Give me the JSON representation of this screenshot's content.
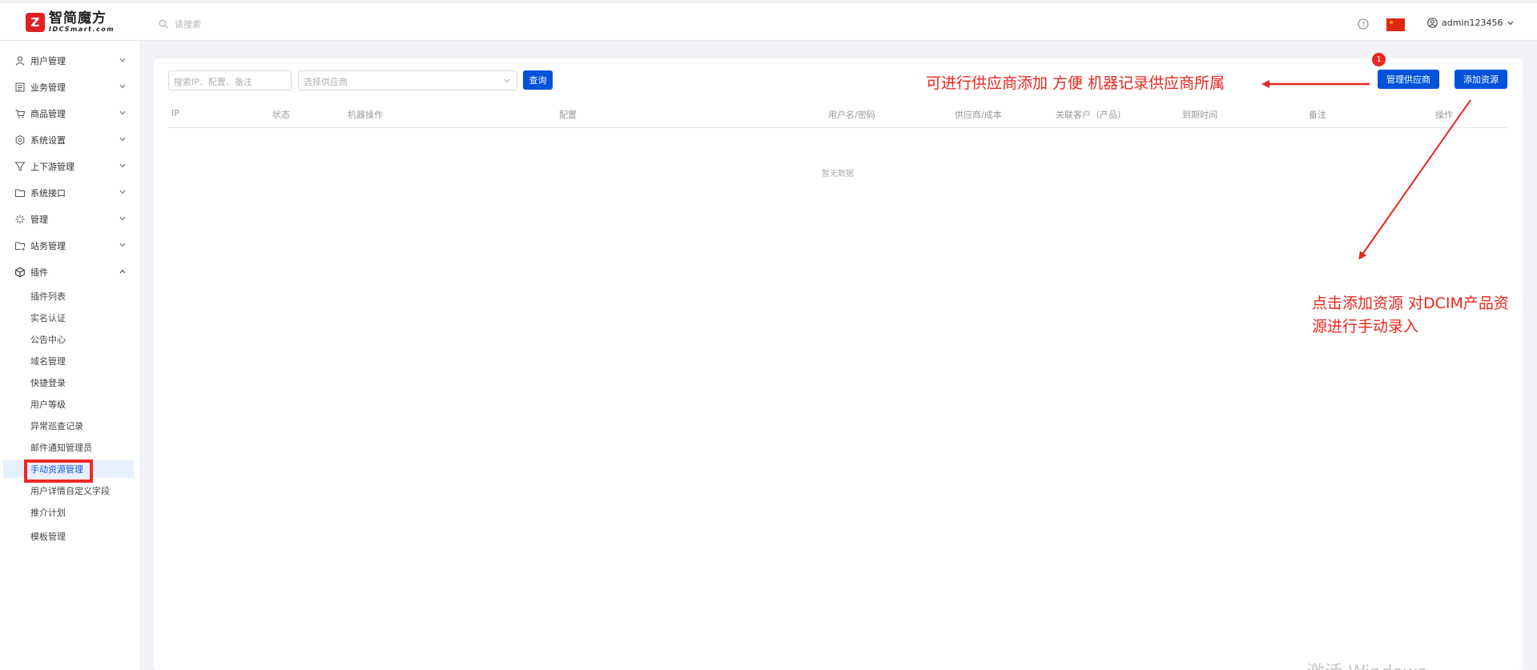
{
  "header": {
    "logo_mark": "Z",
    "logo_cn": "智简魔方",
    "logo_en": "IDCSmart.com",
    "search_placeholder": "请搜索",
    "username": "admin123456"
  },
  "sidebar": {
    "items": [
      {
        "label": "用户管理",
        "icon": "user-icon"
      },
      {
        "label": "业务管理",
        "icon": "document-list-icon"
      },
      {
        "label": "商品管理",
        "icon": "cart-icon"
      },
      {
        "label": "系统设置",
        "icon": "gear-icon"
      },
      {
        "label": "上下游管理",
        "icon": "filter-icon"
      },
      {
        "label": "系统接口",
        "icon": "folder-icon"
      },
      {
        "label": "管理",
        "icon": "sparkle-icon"
      },
      {
        "label": "站务管理",
        "icon": "folder-plus-icon"
      },
      {
        "label": "插件",
        "icon": "cube-icon",
        "expanded": true
      }
    ],
    "plugin_children": [
      {
        "label": "插件列表"
      },
      {
        "label": "实名认证"
      },
      {
        "label": "公告中心"
      },
      {
        "label": "域名管理"
      },
      {
        "label": "快捷登录"
      },
      {
        "label": "用户等级"
      },
      {
        "label": "异常巡查记录"
      },
      {
        "label": "邮件通知管理员"
      },
      {
        "label": "手动资源管理",
        "active": true
      },
      {
        "label": "用户详情自定义字段"
      },
      {
        "label": "推介计划"
      },
      {
        "label": "模板管理"
      }
    ]
  },
  "toolbar": {
    "search_placeholder": "搜索IP、配置、备注",
    "supplier_placeholder": "选择供应商",
    "query_label": "查询",
    "manage_supplier_label": "管理供应商",
    "add_resource_label": "添加资源"
  },
  "table": {
    "columns": [
      "IP",
      "状态",
      "机器操作",
      "配置",
      "用户名/密码",
      "供应商/成本",
      "关联客户（产品）",
      "到期时间",
      "备注",
      "操作"
    ],
    "empty_text": "暂无数据"
  },
  "annotations": {
    "badge": "1",
    "note_supplier": "可进行供应商添加 方便 机器记录供应商所属",
    "note_add_line1": "点击添加资源 对DCIM产品资",
    "note_add_line2": "源进行手动录入",
    "color": "#e8271e"
  },
  "watermark": "激活 Windows",
  "colors": {
    "primary": "#0052d9",
    "active_bg": "#e6f0ff",
    "page_bg": "#f0f2f5",
    "highlight": "#f02828"
  }
}
